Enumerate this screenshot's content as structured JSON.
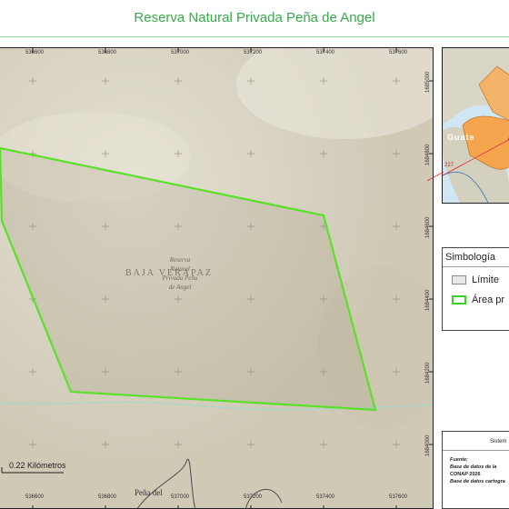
{
  "page": {
    "title": "Reserva Natural Privada Peña de Angel"
  },
  "map": {
    "department_label": "BAJA VERAPAZ",
    "reserve_label": [
      "Reserva",
      "Natural",
      "Privada Peña",
      "de Angel"
    ],
    "place_label": "Peña del",
    "x_ticks": [
      "536600",
      "536800",
      "537000",
      "537200",
      "537400",
      "537600"
    ],
    "y_ticks": [
      "1685000",
      "1684800",
      "1684600",
      "1684400",
      "1684200",
      "1684000"
    ],
    "scale_label": "0.22 Kilómetros",
    "colors": {
      "polygon": "#5be02a",
      "terrain": "#d8d3c3",
      "river": "#a9d6c9"
    }
  },
  "inset": {
    "country_label": "Guate",
    "number_label": "227"
  },
  "legend": {
    "title": "Simbología",
    "items": [
      {
        "label": "Límite",
        "swatch_fill": "#e8e8e8",
        "swatch_border": "#8a8a8a"
      },
      {
        "label": "Área pr",
        "swatch_fill": "#ffffff",
        "swatch_border": "#3bcf2a"
      }
    ]
  },
  "info": {
    "system": "Sistem",
    "source_heading": "Fuente:",
    "lines": [
      "Base de datos de la",
      "CONAP 2026",
      "Base de datos cartogra"
    ]
  }
}
